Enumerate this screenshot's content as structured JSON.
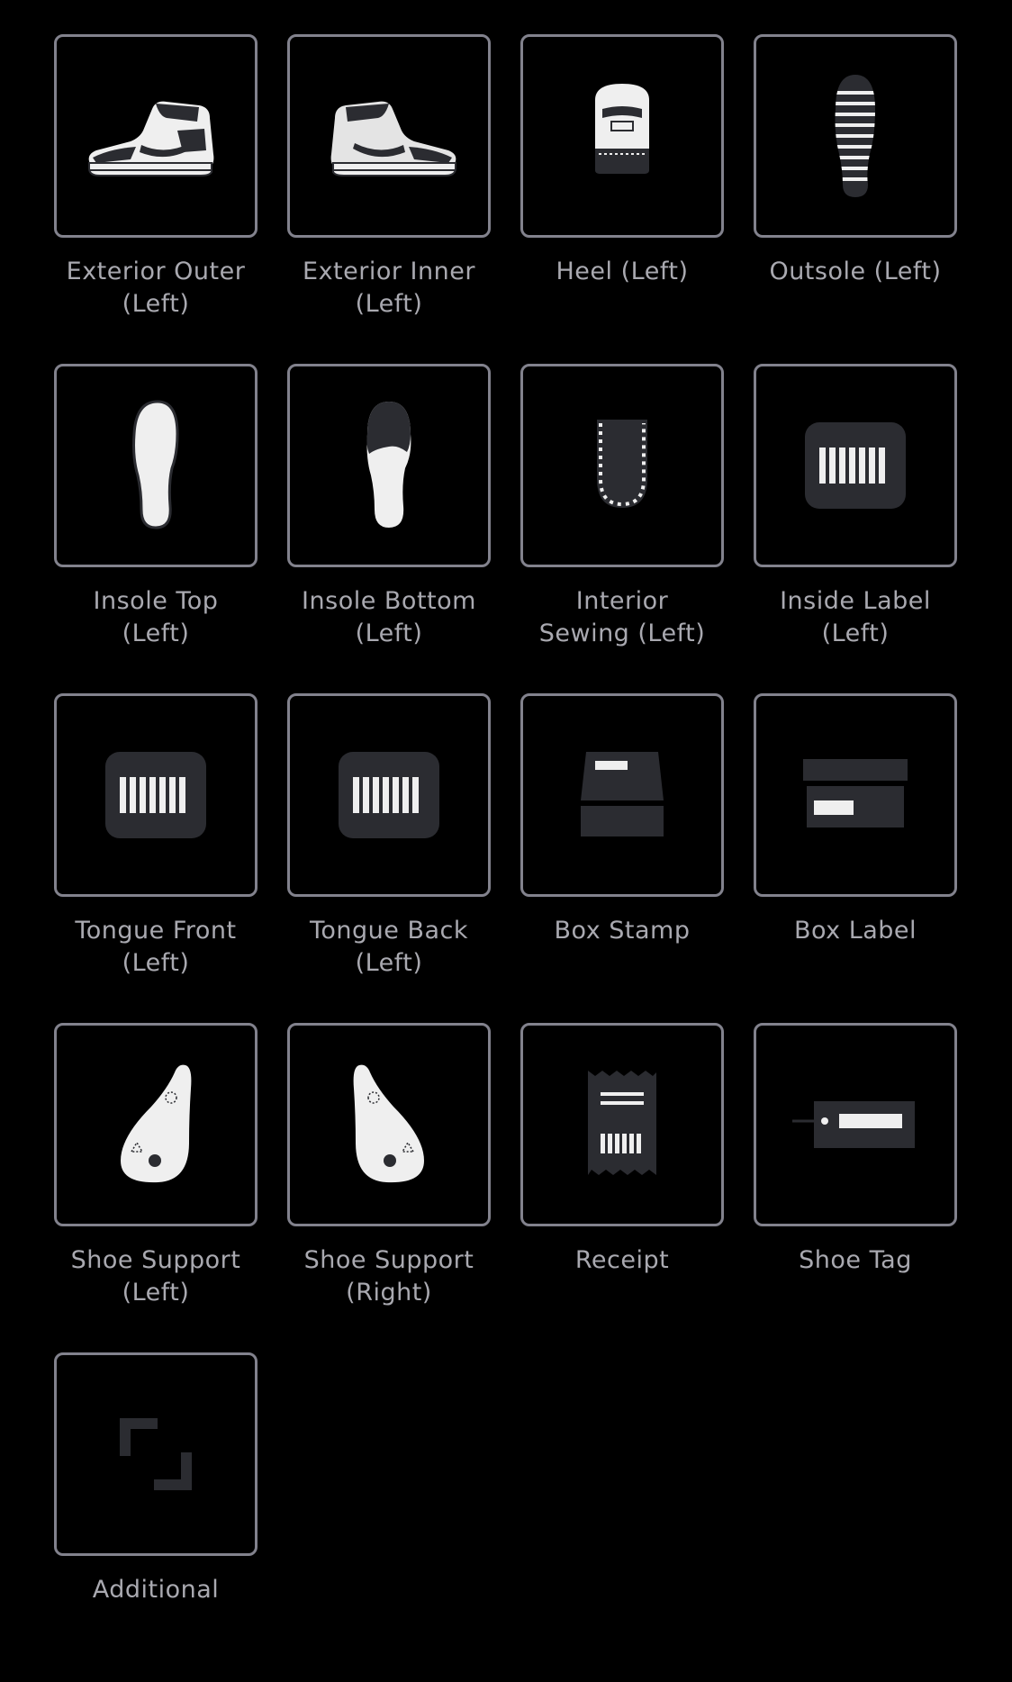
{
  "tiles": [
    {
      "label": "Exterior Outer\n(Left)",
      "icon": "sneaker-outer-icon"
    },
    {
      "label": "Exterior Inner\n(Left)",
      "icon": "sneaker-inner-icon"
    },
    {
      "label": "Heel (Left)",
      "icon": "heel-icon"
    },
    {
      "label": "Outsole (Left)",
      "icon": "outsole-icon"
    },
    {
      "label": "Insole Top\n(Left)",
      "icon": "insole-top-icon"
    },
    {
      "label": "Insole Bottom\n(Left)",
      "icon": "insole-bottom-icon"
    },
    {
      "label": "Interior\nSewing (Left)",
      "icon": "interior-sewing-icon"
    },
    {
      "label": "Inside Label\n(Left)",
      "icon": "barcode-label-icon"
    },
    {
      "label": "Tongue Front\n(Left)",
      "icon": "barcode-label-icon"
    },
    {
      "label": "Tongue Back\n(Left)",
      "icon": "barcode-label-icon"
    },
    {
      "label": "Box Stamp",
      "icon": "box-stamp-icon"
    },
    {
      "label": "Box Label",
      "icon": "box-label-icon"
    },
    {
      "label": "Shoe Support\n(Left)",
      "icon": "shoe-support-left-icon"
    },
    {
      "label": "Shoe Support\n(Right)",
      "icon": "shoe-support-right-icon"
    },
    {
      "label": "Receipt",
      "icon": "receipt-icon"
    },
    {
      "label": "Shoe Tag",
      "icon": "shoe-tag-icon"
    },
    {
      "label": "Additional",
      "icon": "add-photo-frame-icon"
    }
  ],
  "colors": {
    "background": "#000000",
    "tile_border": "#82828d",
    "label": "#a9a9b0",
    "icon_light": "#efefef",
    "icon_dark": "#2b2c31"
  }
}
